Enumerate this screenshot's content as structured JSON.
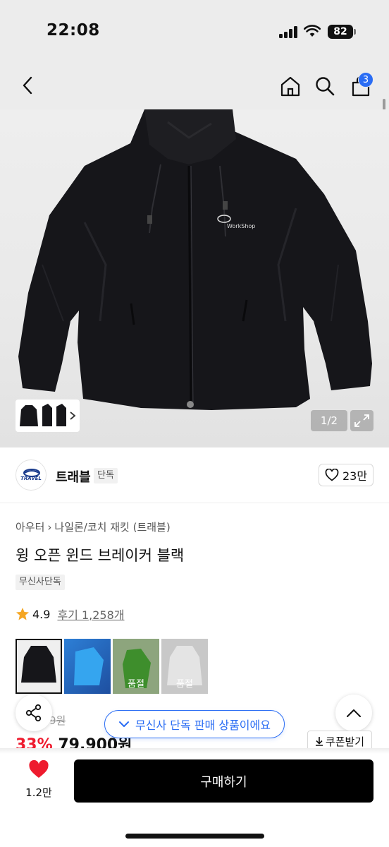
{
  "status_bar": {
    "time": "22:08",
    "battery": "82"
  },
  "nav": {
    "cart_count": "3"
  },
  "gallery": {
    "counter": "1/2",
    "logo_text": "WorkShop"
  },
  "brand": {
    "name": "트래블",
    "tag": "단독",
    "likes": "23만",
    "logo_text": "TRAVEL"
  },
  "product": {
    "breadcrumb": [
      "아우터",
      "나일론/코치 재킷 (트래블)"
    ],
    "title": "윙 오픈 윈드 브레이커 블랙",
    "tag": "무신사단독",
    "rating": "4.9",
    "review_label": "후기 1,258개",
    "colors": [
      {
        "label": ""
      },
      {
        "label": ""
      },
      {
        "label": "품절"
      },
      {
        "label": "품절"
      }
    ],
    "original_price": "9원",
    "discount": "33%",
    "price": "79,900원"
  },
  "banner_text": "무신사 단독 판매 상품이에요",
  "coupon_label": "쿠폰받기",
  "bottom": {
    "fav_count": "1.2만",
    "buy_label": "구매하기"
  },
  "colors": {
    "accent": "#2a6df4",
    "discount": "#ee1b2e",
    "star": "#f5a623",
    "heart": "#ee1b2e"
  }
}
